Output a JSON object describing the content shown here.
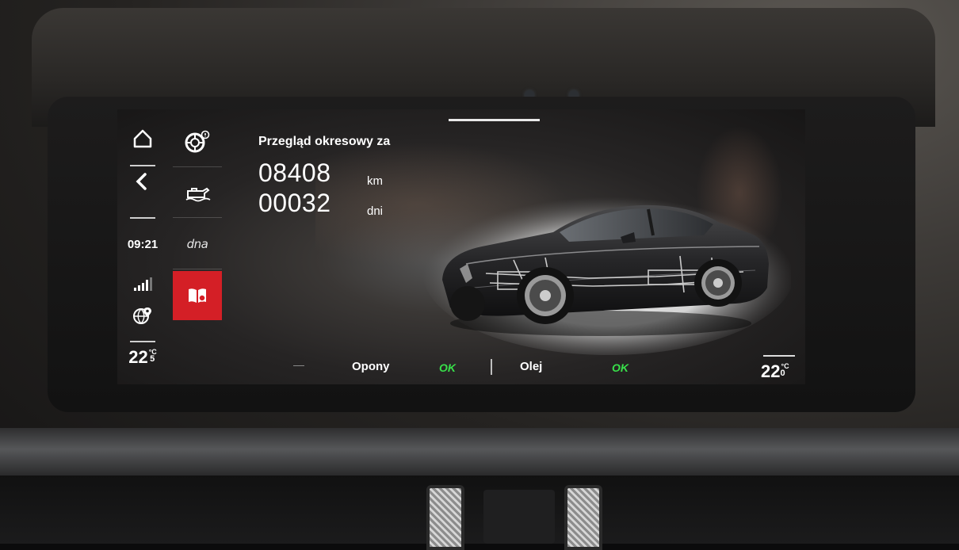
{
  "left_column": {
    "home_icon": "home-icon",
    "back_icon": "back-arrow-icon",
    "clock": "09:21",
    "signal_icon": "signal-bars-icon",
    "nav_icon": "globe-pin-icon",
    "temperature": {
      "integer": "22",
      "decimal": "5",
      "unit": "°C"
    }
  },
  "mid_column": {
    "items": [
      {
        "icon": "tire-service-icon"
      },
      {
        "icon": "oil-level-icon"
      },
      {
        "label": "dna"
      },
      {
        "icon": "manual-book-icon",
        "active": true
      }
    ],
    "active_color": "#d41f26"
  },
  "service": {
    "title": "Przegląd okresowy za",
    "km_value": "08408",
    "km_unit": "km",
    "days_value": "00032",
    "days_unit": "dni"
  },
  "status": {
    "tires_label": "Opony",
    "tires_status": "OK",
    "oil_label": "Olej",
    "oil_status": "OK",
    "ok_color": "#38e04a"
  },
  "right_temperature": {
    "integer": "22",
    "decimal": "0",
    "unit": "°C"
  }
}
